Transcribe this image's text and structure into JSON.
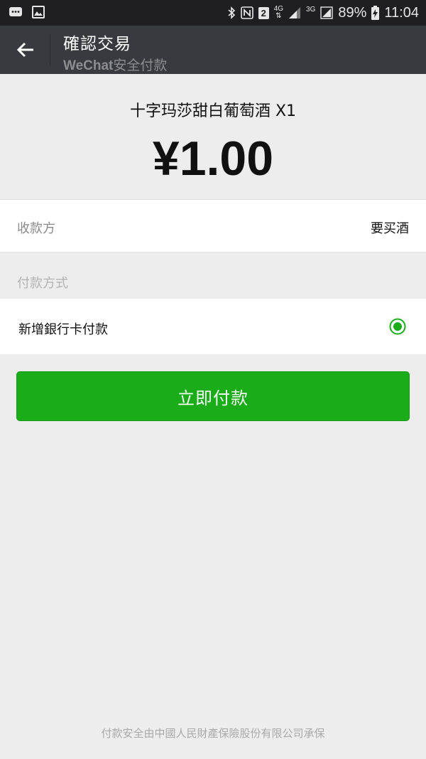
{
  "status_bar": {
    "network_4g": "4G",
    "network_3g": "3G",
    "sim_slot": "2",
    "battery": "89%",
    "time": "11:04"
  },
  "header": {
    "title": "確認交易",
    "subtitle_brand": "WeChat",
    "subtitle_rest": "安全付款"
  },
  "product": {
    "name": "十字玛莎甜白葡萄酒 X1",
    "price": "¥1.00"
  },
  "payee": {
    "label": "收款方",
    "value": "要买酒"
  },
  "payment_method": {
    "section_label": "付款方式",
    "option_label": "新增銀行卡付款",
    "selected": true
  },
  "pay_button": {
    "label": "立即付款"
  },
  "footer": {
    "note": "付款安全由中國人民財產保險股份有限公司承保"
  },
  "colors": {
    "accent_green": "#1aad19",
    "title_bar": "#393a3f",
    "status_bar": "#1f1f21",
    "background": "#ededed"
  },
  "icons": {
    "back": "arrow-left-icon",
    "radio": "radio-selected-icon"
  }
}
